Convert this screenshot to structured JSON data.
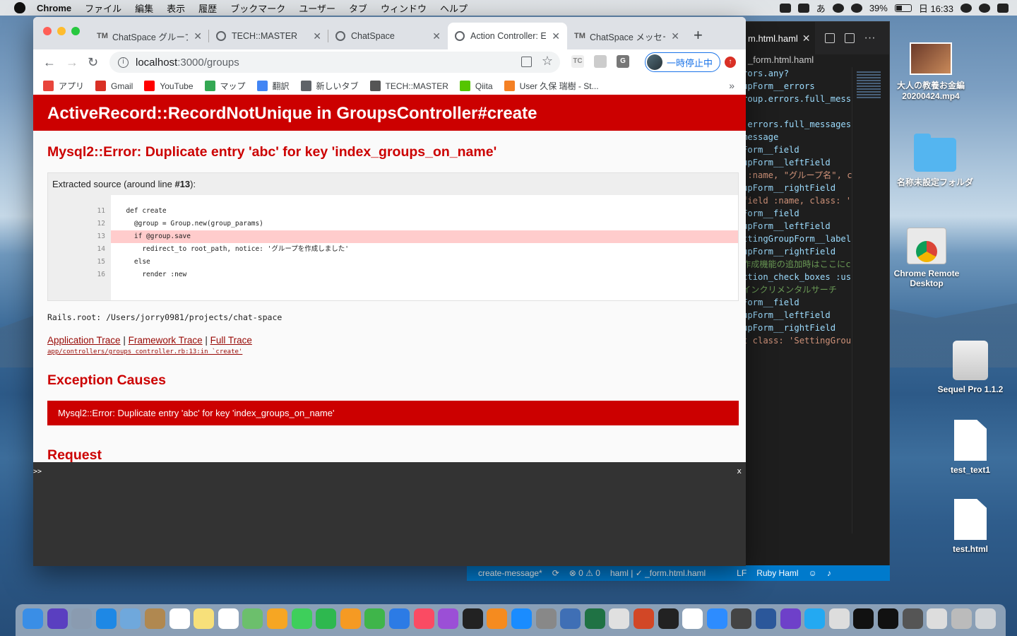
{
  "menubar": {
    "app": "Chrome",
    "items": [
      "ファイル",
      "編集",
      "表示",
      "履歴",
      "ブックマーク",
      "ユーザー",
      "タブ",
      "ウィンドウ",
      "ヘルプ"
    ],
    "input_method": "あ",
    "battery": "39%",
    "clock": "日 16:33"
  },
  "editor": {
    "tab_title": "_form.html.haml",
    "tab_display": "m.html.haml",
    "breadcrumb": "_form.html.haml",
    "code_lines": [
      "rors.any?",
      "upForm__errors",
      "roup.errors.full_mess",
      "",
      ".errors.full_messages",
      "message",
      "Form__field",
      "upForm__leftField",
      " :name, \"グループ名\", c",
      "upForm__rightField",
      "field :name, class: '",
      "Form__field",
      "upForm__leftField",
      "ttingGroupForm__label",
      "upForm__rightField",
      "作成機能の追加時はここにc",
      "ction_check_boxes :us",
      "インクリメンタルサーチ",
      "Form__field",
      "upForm__leftField",
      "upForm__rightField",
      "t class: 'SettingGrou"
    ],
    "status": {
      "branch": "create-message*",
      "problems": "⊗ 0 ⚠ 0",
      "file": "haml | ✓ _form.html.haml",
      "eol": "LF",
      "language": "Ruby Haml"
    }
  },
  "desktop": {
    "icons": [
      {
        "label": "大人の教養お金編 20200424.mp4",
        "kind": "thumb"
      },
      {
        "label": "名称未設定フォルダ",
        "kind": "folder"
      },
      {
        "label": "Chrome Remote Desktop",
        "kind": "chrome-remote"
      },
      {
        "label": "Sequel Pro 1.1.2",
        "kind": "disk"
      },
      {
        "label": "test_text1",
        "kind": "doc"
      },
      {
        "label": "test.html",
        "kind": "doc"
      }
    ]
  },
  "browser": {
    "tabs": [
      {
        "favicon": "TM",
        "title": "ChatSpace グループ"
      },
      {
        "favicon": "globe",
        "title": "TECH::MASTER"
      },
      {
        "favicon": "globe",
        "title": "ChatSpace"
      },
      {
        "favicon": "globe",
        "title": "Action Controller: Exception caught",
        "active": true
      },
      {
        "favicon": "TM",
        "title": "ChatSpace メッセージ"
      }
    ],
    "url_host": "localhost",
    "url_path": ":3000/groups",
    "profile_label": "一時停止中",
    "bookmarks": [
      {
        "icon": "apps-icon",
        "label": "アプリ",
        "color": "#e8453c"
      },
      {
        "icon": "gmail-icon",
        "label": "Gmail",
        "color": "#d93025"
      },
      {
        "icon": "youtube-icon",
        "label": "YouTube",
        "color": "#ff0000"
      },
      {
        "icon": "maps-icon",
        "label": "マップ",
        "color": "#34a853"
      },
      {
        "icon": "translate-icon",
        "label": "翻訳",
        "color": "#4285f4"
      },
      {
        "icon": "globe-icon",
        "label": "新しいタブ",
        "color": "#5f6368"
      },
      {
        "icon": "tm-icon",
        "label": "TECH::MASTER",
        "color": "#555555"
      },
      {
        "icon": "qiita-icon",
        "label": "Qiita",
        "color": "#55c500"
      },
      {
        "icon": "stackoverflow-icon",
        "label": "User 久保 瑞樹 - St...",
        "color": "#f48024"
      }
    ]
  },
  "error_page": {
    "title": "ActiveRecord::RecordNotUnique in GroupsController#create",
    "message": "Mysql2::Error: Duplicate entry 'abc' for key 'index_groups_on_name'",
    "source_caption_prefix": "Extracted source (around line ",
    "source_caption_line": "#13",
    "source_caption_suffix": "):",
    "source": [
      {
        "n": "11",
        "code": "  def create"
      },
      {
        "n": "12",
        "code": "    @group = Group.new(group_params)"
      },
      {
        "n": "13",
        "code": "    if @group.save",
        "highlight": true
      },
      {
        "n": "14",
        "code": "      redirect_to root_path, notice: 'グループを作成しました'"
      },
      {
        "n": "15",
        "code": "    else"
      },
      {
        "n": "16",
        "code": "      render :new"
      }
    ],
    "rails_root": "Rails.root: /Users/jorry0981/projects/chat-space",
    "trace_links": [
      "Application Trace",
      "Framework Trace",
      "Full Trace"
    ],
    "trace_line": "app/controllers/groups_controller.rb:13:in `create'",
    "exception_causes_heading": "Exception Causes",
    "cause_message": "Mysql2::Error: Duplicate entry 'abc' for key 'index_groups_on_name'",
    "request_heading": "Request"
  },
  "console": {
    "prompt": ">>",
    "close": "x"
  },
  "colors": {
    "rails_red": "#cc0000",
    "link": "#980905",
    "vscode_blue": "#007acc"
  }
}
